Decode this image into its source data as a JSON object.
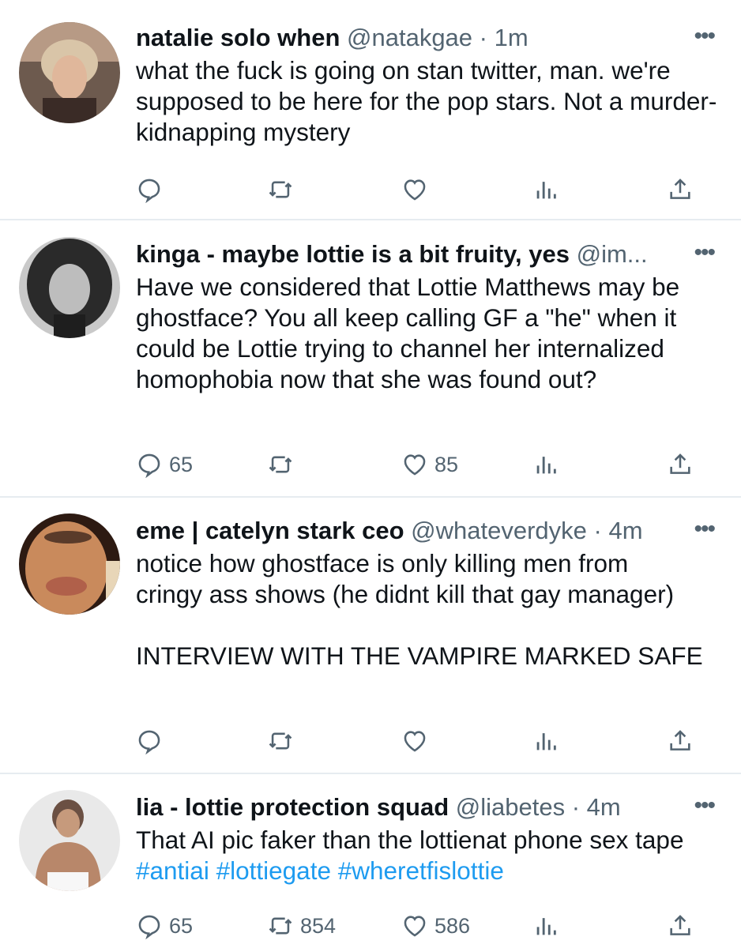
{
  "colors": {
    "text": "#0f1419",
    "muted": "#536471",
    "link": "#1d9bf0",
    "divider": "#e6ecf0"
  },
  "tweets": [
    {
      "name": "natalie solo when",
      "handle": "@natakgae",
      "time": "· 1m",
      "more": "•••",
      "text": "what the fuck is going on stan twitter, man. we're supposed to be here for the pop stars. Not a murder-kidnapping mystery",
      "replies": "",
      "retweets": "",
      "likes": ""
    },
    {
      "name": "kinga - maybe lottie is a bit fruity, yes",
      "handle": "@im...",
      "time": "",
      "more": "•••",
      "text": "Have we considered that Lottie Matthews may be ghostface? You all keep calling GF a \"he\" when it could be Lottie trying to channel her internalized homophobia now that she was found out?",
      "replies": "65",
      "retweets": "",
      "likes": "85"
    },
    {
      "name": "eme | catelyn stark ceo",
      "handle": "@whateverdyke",
      "time": "· 4m",
      "more": "•••",
      "text": "notice how ghostface is only killing men from cringy ass shows (he didnt kill that gay manager)",
      "text2": "INTERVIEW WITH THE VAMPIRE MARKED SAFE",
      "replies": "",
      "retweets": "",
      "likes": ""
    },
    {
      "name": "lia - lottie protection squad",
      "handle": "@liabetes",
      "time": "· 4m",
      "more": "•••",
      "text": "That AI pic faker than the lottienat phone sex tape",
      "hashtags": [
        "#antiai",
        "#lottiegate",
        "#wheretfislottie"
      ],
      "replies": "65",
      "retweets": "854",
      "likes": "586"
    }
  ]
}
